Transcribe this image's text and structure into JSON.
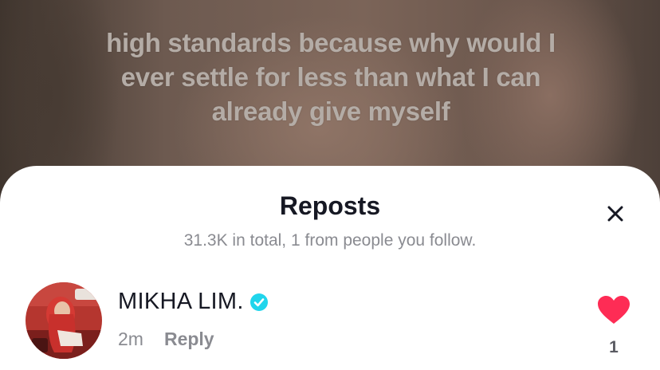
{
  "video": {
    "caption_lines": [
      "high standards because why would I",
      "ever settle for less than what I can",
      "already give myself"
    ]
  },
  "sheet": {
    "title": "Reposts",
    "subtitle": "31.3K in total, 1 from people you follow.",
    "close_icon": "close-icon"
  },
  "reposts": [
    {
      "name": "MIKHA LIM.",
      "verified": true,
      "time": "2m",
      "reply_label": "Reply",
      "like_count": "1",
      "like_color": "#fe2c55",
      "verified_color": "#20d5ec"
    }
  ]
}
